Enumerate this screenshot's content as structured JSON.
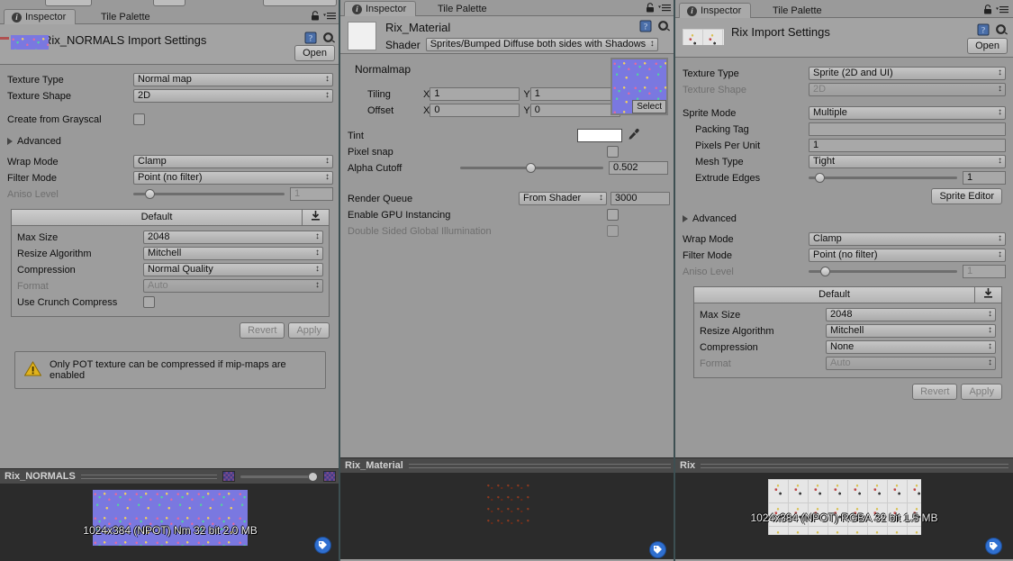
{
  "window": {
    "toolbar_buttons": [
      "",
      "",
      "",
      "",
      ""
    ]
  },
  "panels": [
    {
      "id": "normals",
      "tabs": [
        {
          "label": "Inspector",
          "active": true,
          "icon": "info-icon"
        },
        {
          "label": "Tile Palette",
          "active": false
        }
      ],
      "lock_icon": "lock-icon",
      "menu_icon": "hamburger-menu-icon",
      "header": {
        "title": "Rix_NORMALS Import Settings",
        "open_label": "Open",
        "help_icon": "help-book-icon",
        "gear_icon": "gear-icon",
        "thumbnail": "normalmap-thumbnail"
      },
      "rows": [
        {
          "kind": "popup",
          "label": "Texture Type",
          "value": "Normal map"
        },
        {
          "kind": "popup",
          "label": "Texture Shape",
          "value": "2D"
        },
        {
          "kind": "gap"
        },
        {
          "kind": "check",
          "label": "Create from Grayscal",
          "checked": false
        },
        {
          "kind": "gap"
        },
        {
          "kind": "foldout",
          "label": "Advanced",
          "expanded": false
        },
        {
          "kind": "gap"
        },
        {
          "kind": "popup",
          "label": "Wrap Mode",
          "value": "Clamp"
        },
        {
          "kind": "popup",
          "label": "Filter Mode",
          "value": "Point (no filter)"
        },
        {
          "kind": "slider",
          "label": "Aniso Level",
          "value": "1",
          "pos": 8,
          "disabled": true
        }
      ],
      "platform": {
        "tab_label": "Default",
        "download_icon": "download-icon",
        "rows": [
          {
            "kind": "popup",
            "label": "Max Size",
            "value": "2048"
          },
          {
            "kind": "popup",
            "label": "Resize Algorithm",
            "value": "Mitchell"
          },
          {
            "kind": "popup",
            "label": "Compression",
            "value": "Normal Quality"
          },
          {
            "kind": "popup",
            "label": "Format",
            "value": "Auto",
            "disabled": true
          },
          {
            "kind": "check",
            "label": "Use Crunch Compress",
            "checked": false
          }
        ]
      },
      "buttons": {
        "revert": "Revert",
        "apply": "Apply",
        "disabled": true
      },
      "warning": {
        "icon": "warning-triangle-icon",
        "text": "Only POT texture can be compressed if mip-maps are enabled"
      },
      "preview": {
        "title": "Rix_NORMALS",
        "caption": "1024x384 (NPOT)  Nm 32 bit   2.0 MB",
        "checker_icon": "checkerboard-icon",
        "alpha_icon": "alpha-checker-icon",
        "tag_icon": "tag-icon",
        "has_toolbar": true
      }
    },
    {
      "id": "material",
      "tabs": [
        {
          "label": "Inspector",
          "active": true,
          "icon": "info-icon"
        },
        {
          "label": "Tile Palette",
          "active": false
        }
      ],
      "lock_icon": "lock-icon",
      "menu_icon": "hamburger-menu-icon",
      "header": {
        "title": "Rix_Material",
        "shader_label": "Shader",
        "shader_value": "Sprites/Bumped Diffuse both sides with Shadows",
        "help_icon": "help-book-icon",
        "gear_icon": "gear-icon",
        "thumbnail": "material-thumbnail"
      },
      "normalmap": {
        "label": "Normalmap",
        "tiling_label": "Tiling",
        "offset_label": "Offset",
        "x_label": "X",
        "y_label": "Y",
        "tiling_x": "1",
        "tiling_y": "1",
        "offset_x": "0",
        "offset_y": "0",
        "select_label": "Select",
        "preview": "normalmap-texture-preview"
      },
      "tint": {
        "label": "Tint",
        "color": "#ffffff",
        "eyedropper_icon": "eyedropper-icon"
      },
      "pixel_snap": {
        "label": "Pixel snap",
        "checked": false
      },
      "alpha_cutoff": {
        "label": "Alpha Cutoff",
        "value": "0.502",
        "pos": 38
      },
      "render_queue": {
        "label": "Render Queue",
        "mode": "From Shader",
        "value": "3000"
      },
      "gpu_instancing": {
        "label": "Enable GPU Instancing",
        "checked": false
      },
      "double_sided_gi": {
        "label": "Double Sided Global Illumination",
        "checked": false,
        "disabled": true
      },
      "preview": {
        "title": "Rix_Material",
        "caption": "",
        "tag_icon": "tag-icon",
        "has_toolbar": false
      }
    },
    {
      "id": "sprite",
      "tabs": [
        {
          "label": "Inspector",
          "active": true,
          "icon": "info-icon"
        },
        {
          "label": "Tile Palette",
          "active": false
        }
      ],
      "lock_icon": "lock-icon",
      "menu_icon": "hamburger-menu-icon",
      "header": {
        "title": "Rix Import Settings",
        "open_label": "Open",
        "help_icon": "help-book-icon",
        "gear_icon": "gear-icon",
        "thumbnail": "sprite-thumbnail"
      },
      "rows": [
        {
          "kind": "popup",
          "label": "Texture Type",
          "value": "Sprite (2D and UI)"
        },
        {
          "kind": "popup",
          "label": "Texture Shape",
          "value": "2D",
          "disabled": true
        },
        {
          "kind": "gap"
        },
        {
          "kind": "popup",
          "label": "Sprite Mode",
          "value": "Multiple"
        },
        {
          "kind": "field",
          "label": "Packing Tag",
          "value": "",
          "indent": true
        },
        {
          "kind": "field",
          "label": "Pixels Per Unit",
          "value": "1",
          "indent": true
        },
        {
          "kind": "popup",
          "label": "Mesh Type",
          "value": "Tight",
          "indent": true
        },
        {
          "kind": "slider",
          "label": "Extrude Edges",
          "value": "1",
          "pos": 4,
          "indent": true
        }
      ],
      "sprite_editor_label": "Sprite Editor",
      "advanced": {
        "label": "Advanced",
        "expanded": false
      },
      "rows2": [
        {
          "kind": "popup",
          "label": "Wrap Mode",
          "value": "Clamp"
        },
        {
          "kind": "popup",
          "label": "Filter Mode",
          "value": "Point (no filter)"
        },
        {
          "kind": "slider",
          "label": "Aniso Level",
          "value": "1",
          "pos": 8,
          "disabled": true
        }
      ],
      "platform": {
        "tab_label": "Default",
        "download_icon": "download-icon",
        "rows": [
          {
            "kind": "popup",
            "label": "Max Size",
            "value": "2048"
          },
          {
            "kind": "popup",
            "label": "Resize Algorithm",
            "value": "Mitchell"
          },
          {
            "kind": "popup",
            "label": "Compression",
            "value": "None"
          },
          {
            "kind": "popup",
            "label": "Format",
            "value": "Auto",
            "disabled": true
          }
        ]
      },
      "buttons": {
        "revert": "Revert",
        "apply": "Apply",
        "disabled": true
      },
      "preview": {
        "title": "Rix",
        "caption": "1024x384 (NPOT)  RGBA 32 bit  1.5 MB",
        "tag_icon": "tag-icon",
        "has_toolbar": false
      }
    }
  ]
}
